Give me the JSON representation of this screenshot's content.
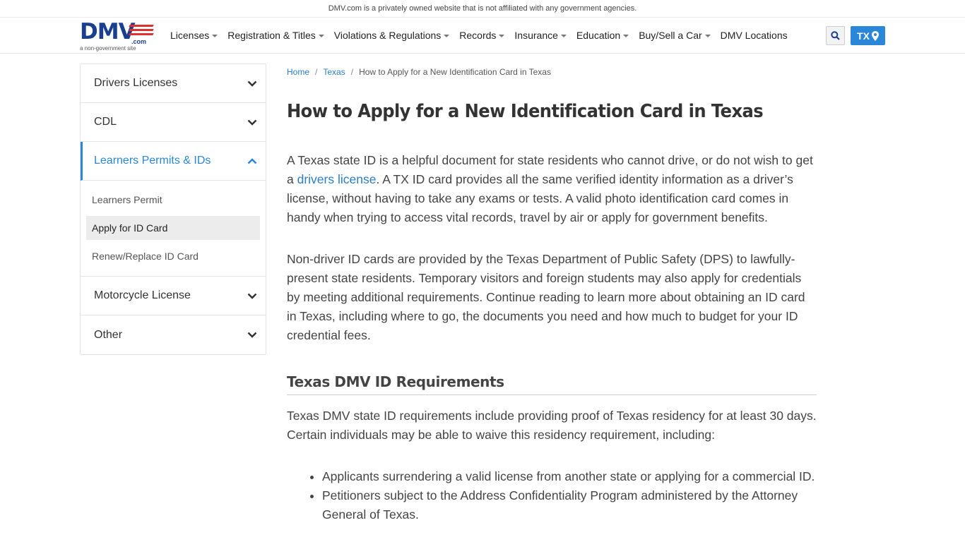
{
  "topbar": {
    "disclaimer": "DMV.com is a privately owned website that is not affiliated with any government agencies."
  },
  "logo": {
    "main": "DMV",
    "dotcom": ".com",
    "tagline": "a non-government site"
  },
  "nav": {
    "items": [
      {
        "label": "Licenses",
        "dropdown": true
      },
      {
        "label": "Registration & Titles",
        "dropdown": true
      },
      {
        "label": "Violations & Regulations",
        "dropdown": true
      },
      {
        "label": "Records",
        "dropdown": true
      },
      {
        "label": "Insurance",
        "dropdown": true
      },
      {
        "label": "Education",
        "dropdown": true
      },
      {
        "label": "Buy/Sell a Car",
        "dropdown": true
      },
      {
        "label": "DMV Locations",
        "dropdown": false
      }
    ],
    "state_label": "TX"
  },
  "sidebar": {
    "sections": [
      {
        "label": "Drivers Licenses",
        "expanded": false
      },
      {
        "label": "CDL",
        "expanded": false
      },
      {
        "label": "Learners Permits & IDs",
        "expanded": true,
        "links": [
          "Learners Permit",
          "Apply for ID Card",
          "Renew/Replace ID Card"
        ]
      },
      {
        "label": "Motorcycle License",
        "expanded": false
      },
      {
        "label": "Other",
        "expanded": false
      }
    ]
  },
  "breadcrumb": {
    "home": "Home",
    "state": "Texas",
    "current": "How to Apply for a New Identification Card in Texas"
  },
  "article": {
    "title": "How to Apply for a New Identification Card in Texas",
    "p1_a": "A Texas state ID is a helpful document for state residents who cannot drive, or do not wish to get a ",
    "p1_link": "drivers license",
    "p1_b": ". A TX ID card provides all the same verified identity information as a driver’s license, without having to take any exams or tests. A valid photo identification card comes in handy when trying to access vital records, travel by air or apply for government benefits.",
    "p2": "Non-driver ID cards are provided by the Texas Department of Public Safety (DPS) to lawfully-present state residents. Temporary visitors and foreign students may also apply for credentials by meeting additional requirements. Continue reading to learn more about obtaining an ID card in Texas, including where to go, the documents you need and how much to budget for your ID credential fees.",
    "h2": "Texas DMV ID Requirements",
    "p3": "Texas DMV state ID requirements include providing proof of Texas residency for at least 30 days. Certain individuals may be able to waive this residency requirement, including:",
    "bullets": [
      "Applicants surrendering a valid license from another state or applying for a commercial ID.",
      "Petitioners subject to the Address Confidentiality Program administered by the Attorney General of Texas."
    ]
  }
}
